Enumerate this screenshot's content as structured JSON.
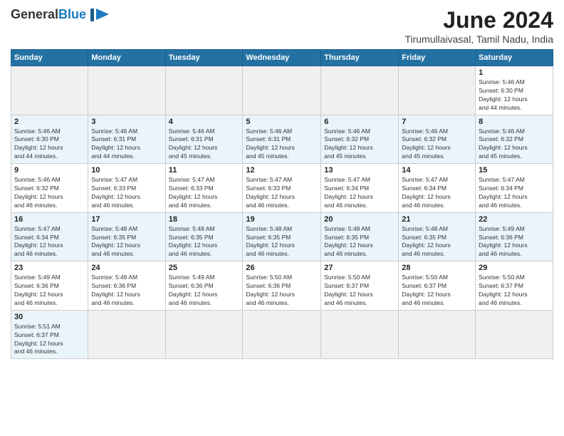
{
  "header": {
    "logo_line1": "General",
    "logo_line2": "Blue",
    "month_title": "June 2024",
    "location": "Tirumullaivasal, Tamil Nadu, India"
  },
  "weekdays": [
    "Sunday",
    "Monday",
    "Tuesday",
    "Wednesday",
    "Thursday",
    "Friday",
    "Saturday"
  ],
  "weeks": [
    {
      "rowClass": "week-row-1",
      "days": [
        {
          "date": "",
          "info": "",
          "empty": true
        },
        {
          "date": "",
          "info": "",
          "empty": true
        },
        {
          "date": "",
          "info": "",
          "empty": true
        },
        {
          "date": "",
          "info": "",
          "empty": true
        },
        {
          "date": "",
          "info": "",
          "empty": true
        },
        {
          "date": "",
          "info": "",
          "empty": true
        },
        {
          "date": "1",
          "info": "Sunrise: 5:46 AM\nSunset: 6:30 PM\nDaylight: 12 hours\nand 44 minutes.",
          "empty": false
        }
      ]
    },
    {
      "rowClass": "week-row-2",
      "days": [
        {
          "date": "2",
          "info": "Sunrise: 5:46 AM\nSunset: 6:30 PM\nDaylight: 12 hours\nand 44 minutes.",
          "empty": false
        },
        {
          "date": "3",
          "info": "Sunrise: 5:46 AM\nSunset: 6:31 PM\nDaylight: 12 hours\nand 44 minutes.",
          "empty": false
        },
        {
          "date": "4",
          "info": "Sunrise: 5:46 AM\nSunset: 6:31 PM\nDaylight: 12 hours\nand 45 minutes.",
          "empty": false
        },
        {
          "date": "5",
          "info": "Sunrise: 5:46 AM\nSunset: 6:31 PM\nDaylight: 12 hours\nand 45 minutes.",
          "empty": false
        },
        {
          "date": "6",
          "info": "Sunrise: 5:46 AM\nSunset: 6:32 PM\nDaylight: 12 hours\nand 45 minutes.",
          "empty": false
        },
        {
          "date": "7",
          "info": "Sunrise: 5:46 AM\nSunset: 6:32 PM\nDaylight: 12 hours\nand 45 minutes.",
          "empty": false
        },
        {
          "date": "8",
          "info": "Sunrise: 5:46 AM\nSunset: 6:32 PM\nDaylight: 12 hours\nand 45 minutes.",
          "empty": false
        }
      ]
    },
    {
      "rowClass": "week-row-3",
      "days": [
        {
          "date": "9",
          "info": "Sunrise: 5:46 AM\nSunset: 6:32 PM\nDaylight: 12 hours\nand 46 minutes.",
          "empty": false
        },
        {
          "date": "10",
          "info": "Sunrise: 5:47 AM\nSunset: 6:33 PM\nDaylight: 12 hours\nand 46 minutes.",
          "empty": false
        },
        {
          "date": "11",
          "info": "Sunrise: 5:47 AM\nSunset: 6:33 PM\nDaylight: 12 hours\nand 46 minutes.",
          "empty": false
        },
        {
          "date": "12",
          "info": "Sunrise: 5:47 AM\nSunset: 6:33 PM\nDaylight: 12 hours\nand 46 minutes.",
          "empty": false
        },
        {
          "date": "13",
          "info": "Sunrise: 5:47 AM\nSunset: 6:34 PM\nDaylight: 12 hours\nand 46 minutes.",
          "empty": false
        },
        {
          "date": "14",
          "info": "Sunrise: 5:47 AM\nSunset: 6:34 PM\nDaylight: 12 hours\nand 46 minutes.",
          "empty": false
        },
        {
          "date": "15",
          "info": "Sunrise: 5:47 AM\nSunset: 6:34 PM\nDaylight: 12 hours\nand 46 minutes.",
          "empty": false
        }
      ]
    },
    {
      "rowClass": "week-row-4",
      "days": [
        {
          "date": "16",
          "info": "Sunrise: 5:47 AM\nSunset: 6:34 PM\nDaylight: 12 hours\nand 46 minutes.",
          "empty": false
        },
        {
          "date": "17",
          "info": "Sunrise: 5:48 AM\nSunset: 6:35 PM\nDaylight: 12 hours\nand 46 minutes.",
          "empty": false
        },
        {
          "date": "18",
          "info": "Sunrise: 5:48 AM\nSunset: 6:35 PM\nDaylight: 12 hours\nand 46 minutes.",
          "empty": false
        },
        {
          "date": "19",
          "info": "Sunrise: 5:48 AM\nSunset: 6:35 PM\nDaylight: 12 hours\nand 46 minutes.",
          "empty": false
        },
        {
          "date": "20",
          "info": "Sunrise: 5:48 AM\nSunset: 6:35 PM\nDaylight: 12 hours\nand 46 minutes.",
          "empty": false
        },
        {
          "date": "21",
          "info": "Sunrise: 5:48 AM\nSunset: 6:35 PM\nDaylight: 12 hours\nand 46 minutes.",
          "empty": false
        },
        {
          "date": "22",
          "info": "Sunrise: 5:49 AM\nSunset: 6:36 PM\nDaylight: 12 hours\nand 46 minutes.",
          "empty": false
        }
      ]
    },
    {
      "rowClass": "week-row-5",
      "days": [
        {
          "date": "23",
          "info": "Sunrise: 5:49 AM\nSunset: 6:36 PM\nDaylight: 12 hours\nand 46 minutes.",
          "empty": false
        },
        {
          "date": "24",
          "info": "Sunrise: 5:49 AM\nSunset: 6:36 PM\nDaylight: 12 hours\nand 46 minutes.",
          "empty": false
        },
        {
          "date": "25",
          "info": "Sunrise: 5:49 AM\nSunset: 6:36 PM\nDaylight: 12 hours\nand 46 minutes.",
          "empty": false
        },
        {
          "date": "26",
          "info": "Sunrise: 5:50 AM\nSunset: 6:36 PM\nDaylight: 12 hours\nand 46 minutes.",
          "empty": false
        },
        {
          "date": "27",
          "info": "Sunrise: 5:50 AM\nSunset: 6:37 PM\nDaylight: 12 hours\nand 46 minutes.",
          "empty": false
        },
        {
          "date": "28",
          "info": "Sunrise: 5:50 AM\nSunset: 6:37 PM\nDaylight: 12 hours\nand 46 minutes.",
          "empty": false
        },
        {
          "date": "29",
          "info": "Sunrise: 5:50 AM\nSunset: 6:37 PM\nDaylight: 12 hours\nand 46 minutes.",
          "empty": false
        }
      ]
    },
    {
      "rowClass": "week-row-6",
      "days": [
        {
          "date": "30",
          "info": "Sunrise: 5:51 AM\nSunset: 6:37 PM\nDaylight: 12 hours\nand 46 minutes.",
          "empty": false
        },
        {
          "date": "",
          "info": "",
          "empty": true
        },
        {
          "date": "",
          "info": "",
          "empty": true
        },
        {
          "date": "",
          "info": "",
          "empty": true
        },
        {
          "date": "",
          "info": "",
          "empty": true
        },
        {
          "date": "",
          "info": "",
          "empty": true
        },
        {
          "date": "",
          "info": "",
          "empty": true
        }
      ]
    }
  ]
}
